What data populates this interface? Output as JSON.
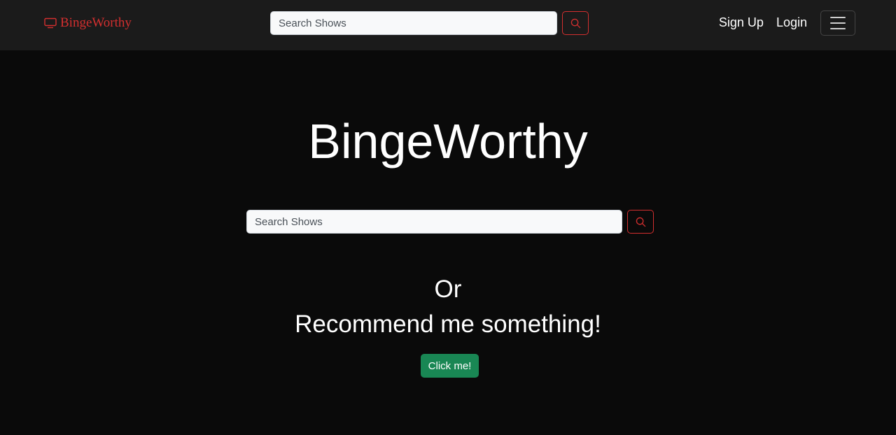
{
  "navbar": {
    "brand": "BingeWorthy",
    "search_placeholder": "Search Shows",
    "links": [
      "Sign Up",
      "Login"
    ]
  },
  "hero": {
    "title": "BingeWorthy",
    "search_placeholder": "Search Shows",
    "or_text": "Or",
    "recommend_text": "Recommend me something!",
    "button_label": "Click me!"
  },
  "icons": {
    "brand_icon": "tv-icon",
    "search_icon": "search-icon",
    "toggler_icon": "hamburger-menu-icon"
  },
  "colors": {
    "brand_accent": "#d32f2f",
    "success_button": "#198754",
    "navbar_bg": "#1b1b1b",
    "page_bg": "#0a0a0a"
  }
}
